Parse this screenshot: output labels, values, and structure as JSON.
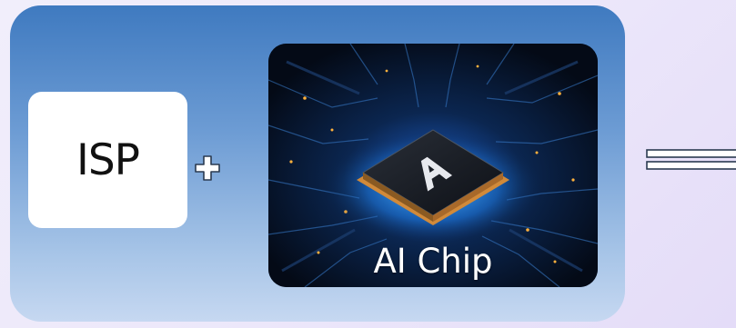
{
  "diagram": {
    "isp_label": "ISP",
    "operator_plus": "+",
    "chip_label": "AI Chip",
    "chip_logo_letter": "A",
    "operator_equals": "="
  },
  "colors": {
    "panel_top": "#3f7ac0",
    "panel_bottom": "#c6d8f1",
    "background": "#ece7fa",
    "chip_glow": "#2f9bff",
    "chip_gold": "#d18a3a"
  }
}
